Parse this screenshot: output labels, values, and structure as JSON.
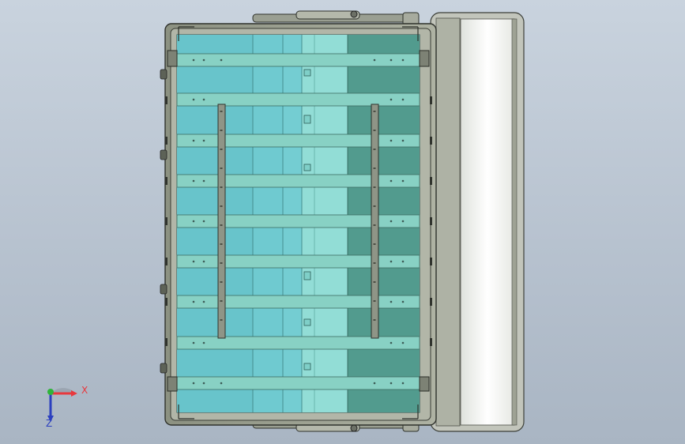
{
  "viewport": {
    "background_top": "#c9d3de",
    "background_bottom": "#a9b5c3"
  },
  "model": {
    "description_colors": {
      "frame": "#9aa08f",
      "frame_edge": "#3a3f38",
      "glass_light": "#8fd6d0",
      "glass_mid": "#63c3c7",
      "glass_dark": "#4f9a8d",
      "slat": "#86cfc3",
      "rail": "#8d9386",
      "panel_white": "#f7f8f6"
    },
    "slat_count": 9,
    "side_bolt_groups": 4
  },
  "triad": {
    "x_label": "X",
    "z_label": "Z",
    "x_color": "#e8383d",
    "y_color": "#2fb53a",
    "z_color": "#2b3fbf"
  }
}
